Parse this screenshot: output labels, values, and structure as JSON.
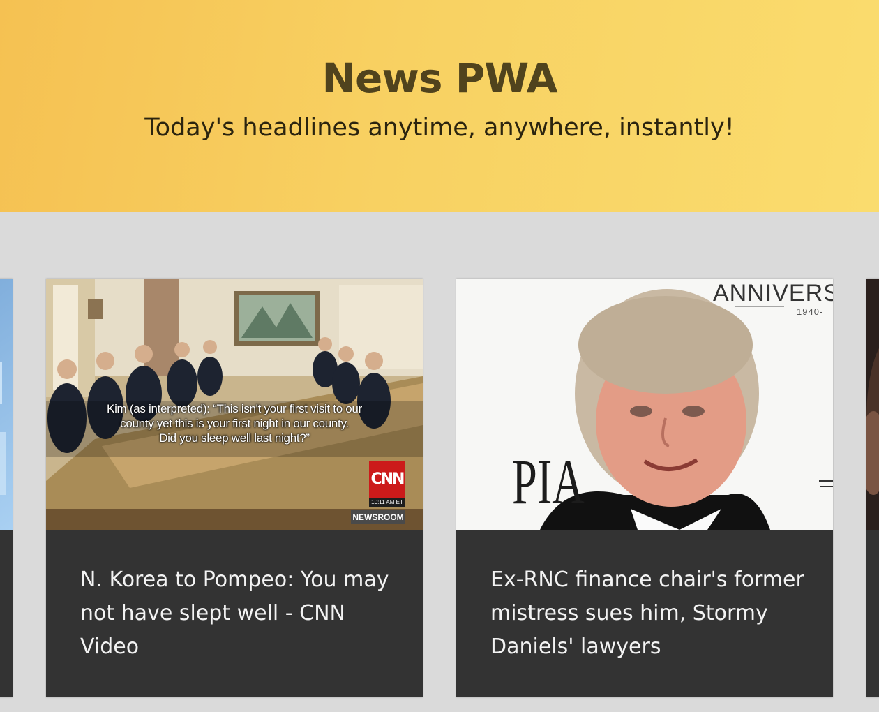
{
  "header": {
    "title": "News PWA",
    "subtitle": "Today's headlines anytime, anywhere, instantly!"
  },
  "cards": [
    {
      "title": "N. Korea to Pompeo: You may not have slept well - CNN Video",
      "image": {
        "caption_line1": "Kim (as interpreted): “This isn't your first visit to our",
        "caption_line2": "county yet this is your first night in our county.",
        "caption_line3": "Did you sleep well last night?”",
        "logo": "CNN",
        "time": "10:11 AM ET",
        "badge": "NEWSROOM"
      }
    },
    {
      "title": "Ex-RNC finance chair's former mistress sues him, Stormy Daniels' lawyers",
      "image": {
        "backdrop_text": "ANNIVERSA",
        "backdrop_year": "1940-",
        "backdrop_letters": "PIA"
      }
    }
  ],
  "colors": {
    "header_gradient_start": "#f5c152",
    "header_gradient_end": "#fadc6e",
    "title": "#50431d",
    "background": "#dadada",
    "card": "#333333"
  }
}
